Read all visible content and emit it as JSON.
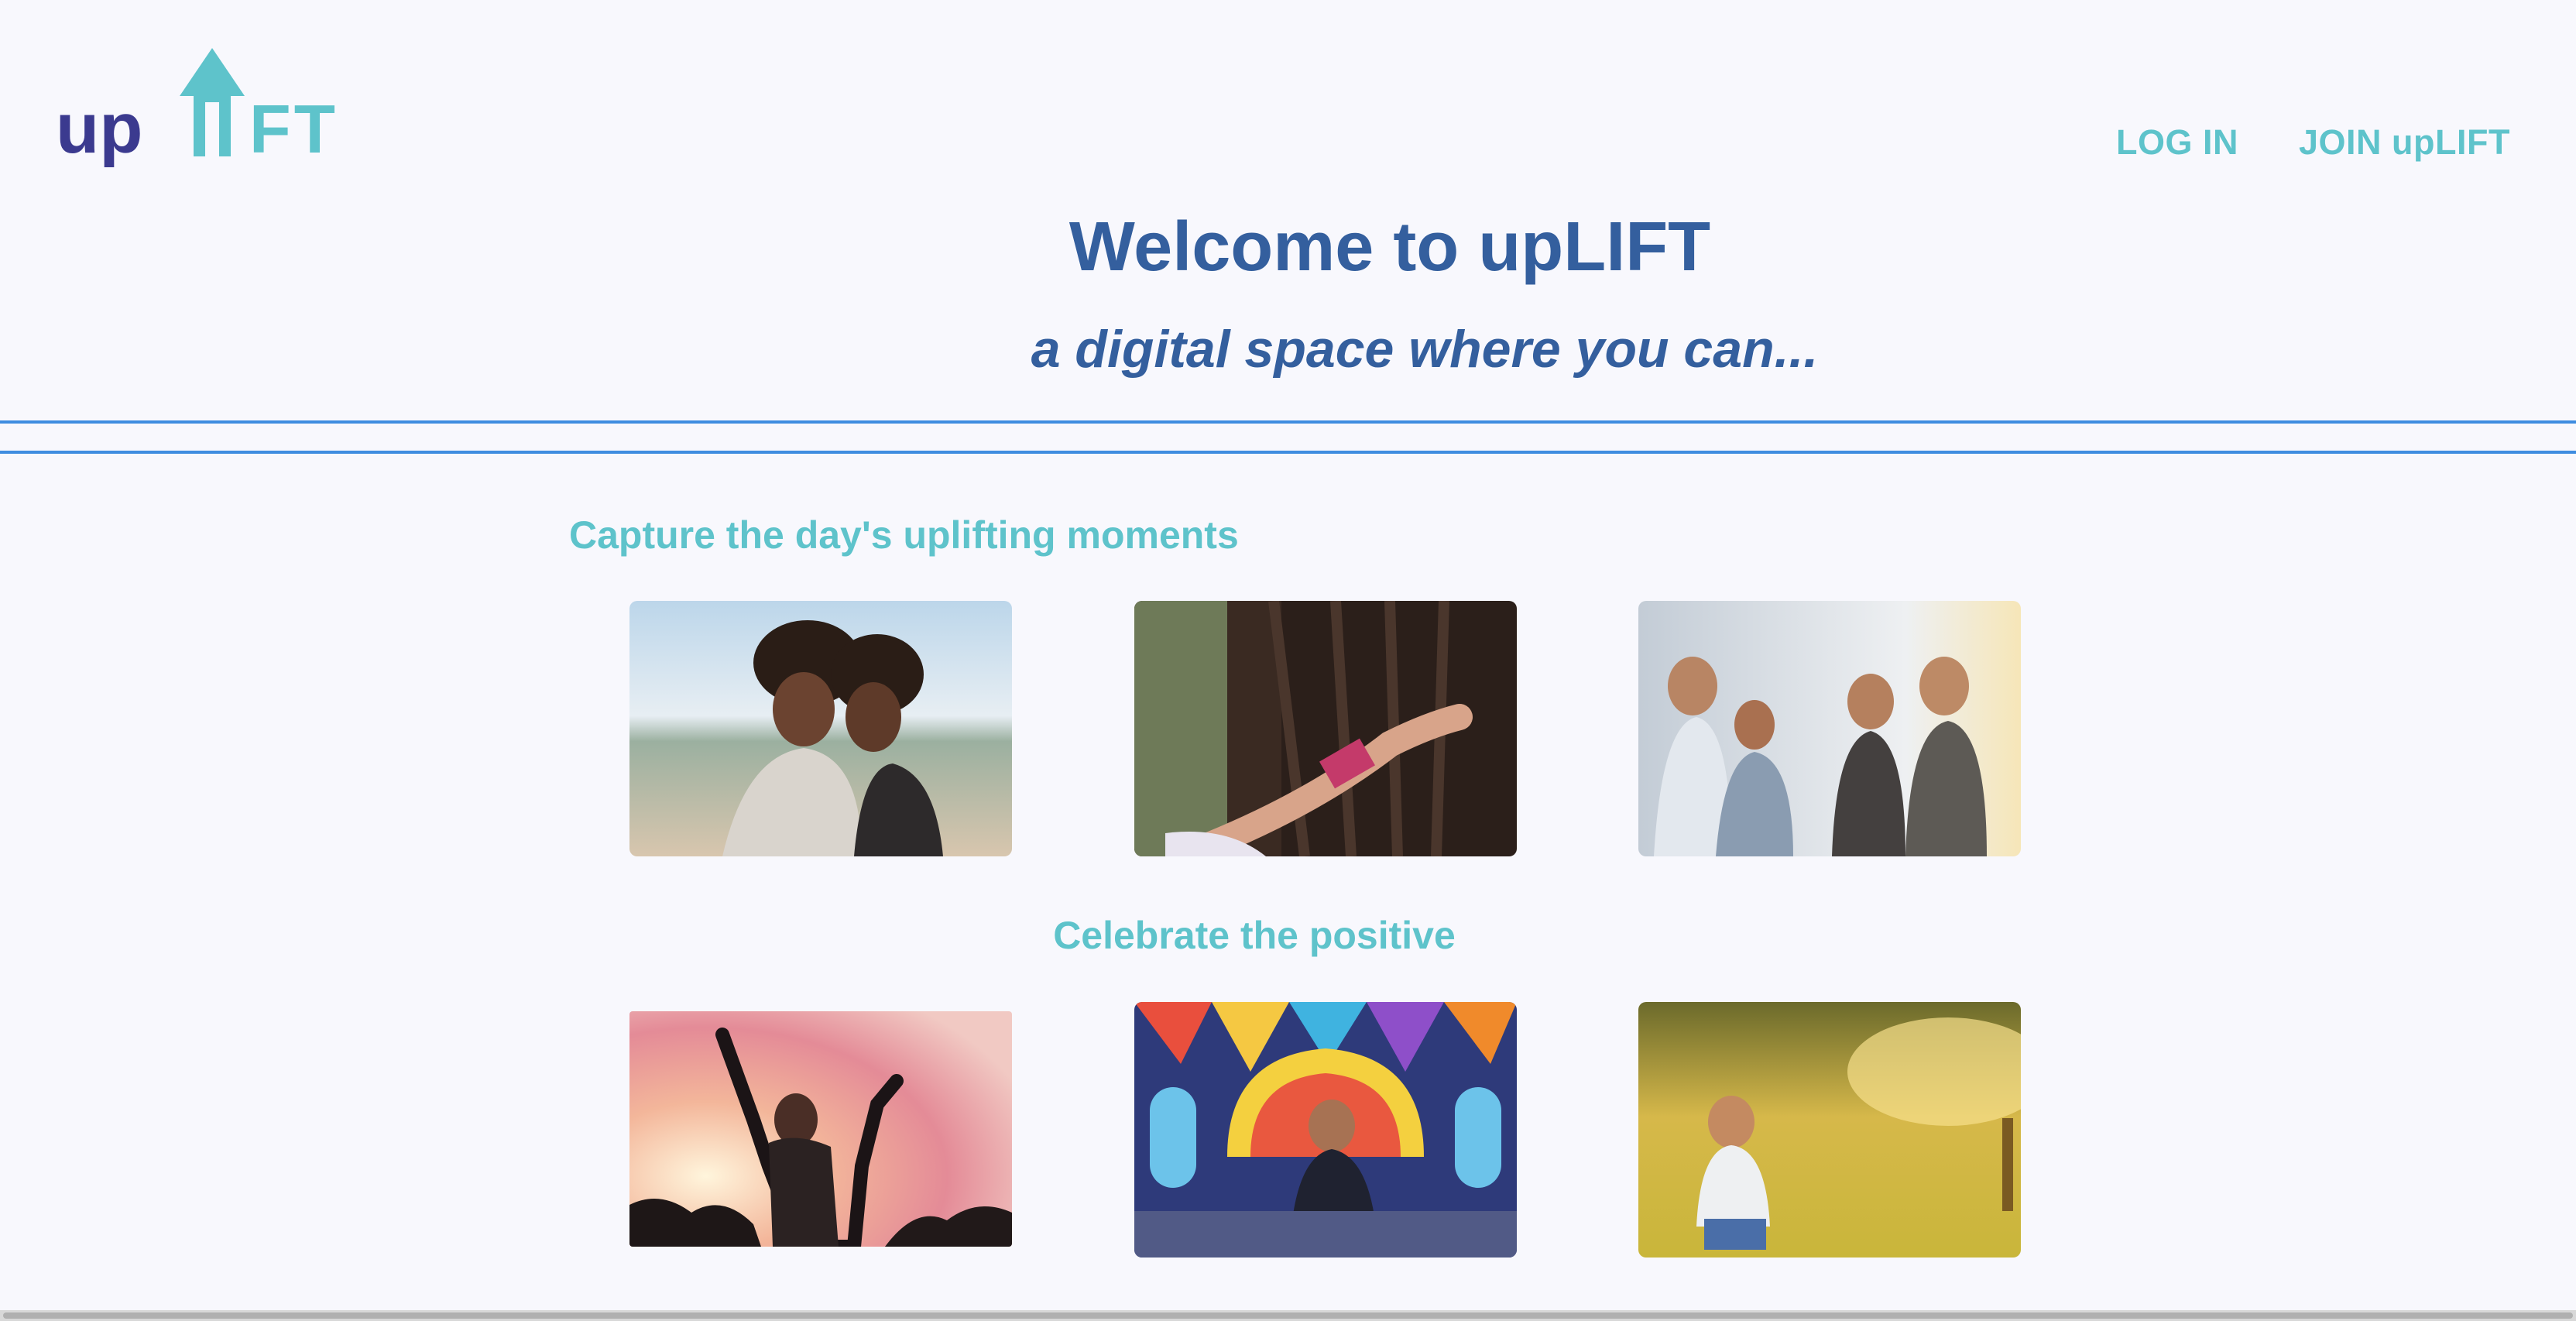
{
  "brand": {
    "logo_text_dark": "up",
    "logo_text_light": "LIFT",
    "dark_color": "#3b3a8f",
    "light_color": "#5ec3cb"
  },
  "nav": {
    "login_label": "LOG IN",
    "join_label": "JOIN upLIFT"
  },
  "hero": {
    "title": "Welcome to upLIFT",
    "tagline": "a digital space where you can..."
  },
  "sections": [
    {
      "heading": "Capture the day's uplifting moments"
    },
    {
      "heading": "Celebrate the positive"
    }
  ],
  "colors": {
    "accent_teal": "#5ec3cb",
    "heading_blue": "#345f9e",
    "rule_blue": "#3f8de0",
    "background": "#f8f8fd"
  }
}
